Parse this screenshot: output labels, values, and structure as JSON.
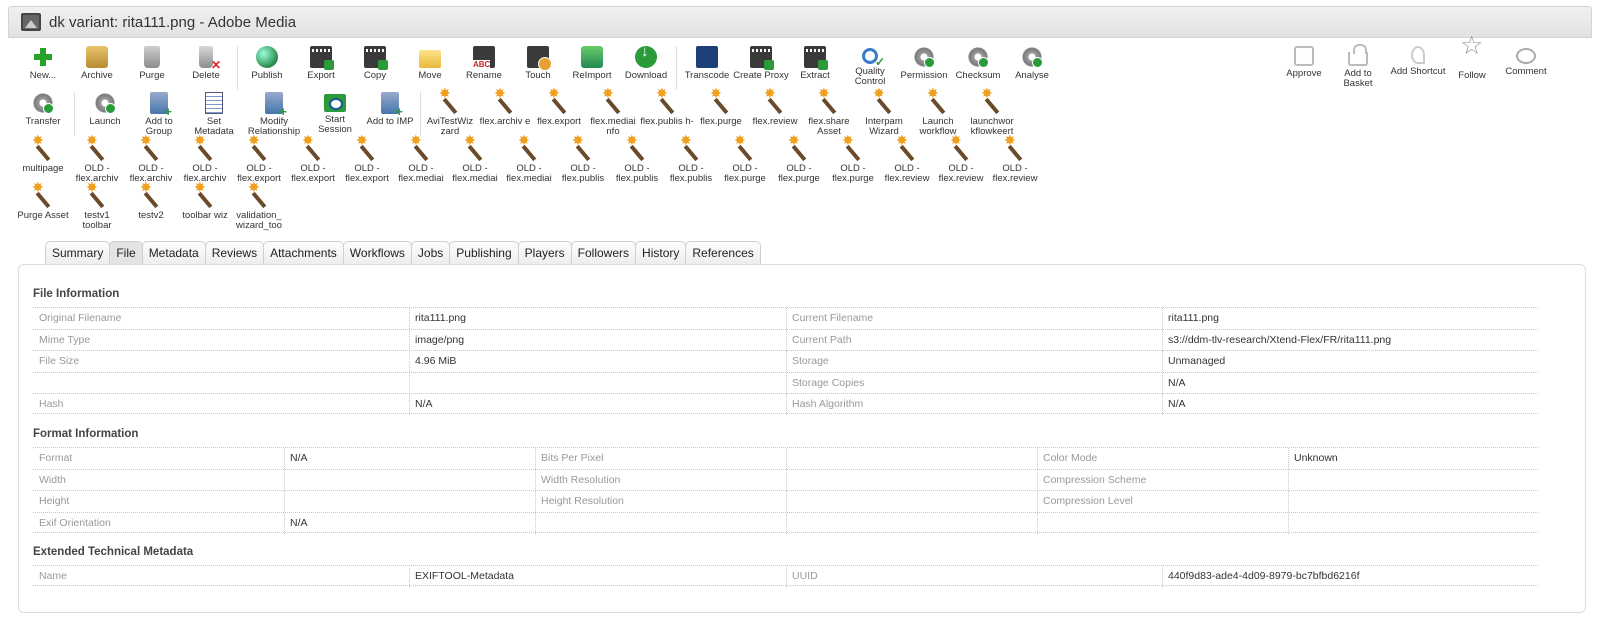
{
  "window": {
    "title": "dk variant: rita111.png - Adobe Media"
  },
  "toolbar": {
    "row1": [
      {
        "label": "New...",
        "icon": "plus-icon"
      },
      {
        "label": "Archive",
        "icon": "archive-icon"
      },
      {
        "label": "Purge",
        "icon": "purge-icon"
      },
      {
        "label": "Delete",
        "icon": "delete-icon"
      },
      {
        "label": "Publish",
        "icon": "publish-icon"
      },
      {
        "label": "Export",
        "icon": "export-icon"
      },
      {
        "label": "Copy",
        "icon": "copy-icon"
      },
      {
        "label": "Move",
        "icon": "move-icon"
      },
      {
        "label": "Rename",
        "icon": "rename-icon"
      },
      {
        "label": "Touch",
        "icon": "touch-icon"
      },
      {
        "label": "ReImport",
        "icon": "reimport-icon"
      },
      {
        "label": "Download",
        "icon": "download-icon"
      },
      {
        "label": "Transcode",
        "icon": "transcode-icon"
      },
      {
        "label": "Create Proxy",
        "icon": "create-proxy-icon"
      },
      {
        "label": "Extract",
        "icon": "extract-icon"
      },
      {
        "label": "Quality Control",
        "icon": "quality-control-icon"
      },
      {
        "label": "Permission",
        "icon": "permission-icon"
      },
      {
        "label": "Checksum",
        "icon": "checksum-icon"
      },
      {
        "label": "Analyse",
        "icon": "analyse-icon"
      }
    ],
    "right": [
      {
        "label": "Approve",
        "icon": "approve-icon"
      },
      {
        "label": "Add to Basket",
        "icon": "basket-icon"
      },
      {
        "label": "Add Shortcut",
        "icon": "shortcut-icon"
      },
      {
        "label": "Follow",
        "icon": "star-icon"
      },
      {
        "label": "Comment",
        "icon": "comment-icon"
      }
    ],
    "row2": [
      {
        "label": "Transfer",
        "icon": "transfer-icon"
      },
      {
        "label": "Launch",
        "icon": "launch-icon"
      },
      {
        "label": "Add to Group",
        "icon": "add-to-group-icon"
      },
      {
        "label": "Set Metadata",
        "icon": "set-metadata-icon"
      },
      {
        "label": "Modify Relationship",
        "icon": "modify-relationship-icon"
      },
      {
        "label": "Start Session",
        "icon": "start-session-icon"
      },
      {
        "label": "Add to IMP",
        "icon": "add-to-imp-icon"
      },
      {
        "label": "AviTestWiz zard",
        "icon": "wand-icon"
      },
      {
        "label": "flex.archiv e",
        "icon": "wand-icon"
      },
      {
        "label": "flex.export",
        "icon": "wand-icon"
      },
      {
        "label": "flex.mediai nfo",
        "icon": "wand-icon"
      },
      {
        "label": "flex.publis h-",
        "icon": "wand-icon"
      },
      {
        "label": "flex.purge",
        "icon": "wand-icon"
      },
      {
        "label": "flex.review",
        "icon": "wand-icon"
      },
      {
        "label": "flex.share Asset",
        "icon": "wand-icon"
      },
      {
        "label": "Interpam Wizard",
        "icon": "wand-icon"
      },
      {
        "label": "Launch workflow",
        "icon": "wand-icon"
      },
      {
        "label": "launchwor kflowkeert",
        "icon": "wand-icon"
      }
    ],
    "row3": [
      {
        "label": "multipage",
        "icon": "wand-icon"
      },
      {
        "label": "OLD - flex.archiv",
        "icon": "wand-icon"
      },
      {
        "label": "OLD - flex.archiv",
        "icon": "wand-icon"
      },
      {
        "label": "OLD - flex.archiv",
        "icon": "wand-icon"
      },
      {
        "label": "OLD - flex.export",
        "icon": "wand-icon"
      },
      {
        "label": "OLD - flex.export",
        "icon": "wand-icon"
      },
      {
        "label": "OLD - flex.export",
        "icon": "wand-icon"
      },
      {
        "label": "OLD - flex.mediai",
        "icon": "wand-icon"
      },
      {
        "label": "OLD - flex.mediai",
        "icon": "wand-icon"
      },
      {
        "label": "OLD - flex.mediai",
        "icon": "wand-icon"
      },
      {
        "label": "OLD - flex.publis",
        "icon": "wand-icon"
      },
      {
        "label": "OLD - flex.publis",
        "icon": "wand-icon"
      },
      {
        "label": "OLD - flex.publis",
        "icon": "wand-icon"
      },
      {
        "label": "OLD - flex.purge",
        "icon": "wand-icon"
      },
      {
        "label": "OLD - flex.purge",
        "icon": "wand-icon"
      },
      {
        "label": "OLD - flex.purge",
        "icon": "wand-icon"
      },
      {
        "label": "OLD - flex.review",
        "icon": "wand-icon"
      },
      {
        "label": "OLD - flex.review",
        "icon": "wand-icon"
      },
      {
        "label": "OLD - flex.review",
        "icon": "wand-icon"
      }
    ],
    "row4": [
      {
        "label": "Purge Asset",
        "icon": "wand-icon"
      },
      {
        "label": "testv1 toolbar",
        "icon": "wand-icon"
      },
      {
        "label": "testv2",
        "icon": "wand-icon"
      },
      {
        "label": "toolbar wiz",
        "icon": "wand-icon"
      },
      {
        "label": "validation_ wizard_too",
        "icon": "wand-icon"
      }
    ]
  },
  "tabs": [
    {
      "label": "Summary",
      "active": false
    },
    {
      "label": "File",
      "active": true
    },
    {
      "label": "Metadata",
      "active": false
    },
    {
      "label": "Reviews",
      "active": false
    },
    {
      "label": "Attachments",
      "active": false
    },
    {
      "label": "Workflows",
      "active": false
    },
    {
      "label": "Jobs",
      "active": false
    },
    {
      "label": "Publishing",
      "active": false
    },
    {
      "label": "Players",
      "active": false
    },
    {
      "label": "Followers",
      "active": false
    },
    {
      "label": "History",
      "active": false
    },
    {
      "label": "References",
      "active": false
    }
  ],
  "file_info": {
    "title": "File Information",
    "rows": [
      [
        "Original Filename",
        "rita111.png",
        "Current Filename",
        "rita111.png"
      ],
      [
        "Mime Type",
        "image/png",
        "Current Path",
        "s3://ddm-tlv-research/Xtend-Flex/FR/rita111.png"
      ],
      [
        "File Size",
        "4.96 MiB",
        "Storage",
        "Unmanaged"
      ],
      [
        "",
        "",
        "Storage Copies",
        "N/A"
      ],
      [
        "Hash",
        "N/A",
        "Hash Algorithm",
        "N/A"
      ]
    ]
  },
  "format_info": {
    "title": "Format Information",
    "rows": [
      [
        "Format",
        "N/A",
        "Bits Per Pixel",
        "",
        "Color Mode",
        "Unknown"
      ],
      [
        "Width",
        "",
        "Width Resolution",
        "",
        "Compression Scheme",
        ""
      ],
      [
        "Height",
        "",
        "Height Resolution",
        "",
        "Compression Level",
        ""
      ],
      [
        "Exif Orientation",
        "N/A",
        "",
        "",
        "",
        ""
      ]
    ]
  },
  "extended_meta": {
    "title": "Extended Technical Metadata",
    "rows": [
      [
        "Name",
        "EXIFTOOL-Metadata",
        "UUID",
        "440f9d83-ade4-4d09-8979-bc7bfbd6216f"
      ]
    ]
  }
}
